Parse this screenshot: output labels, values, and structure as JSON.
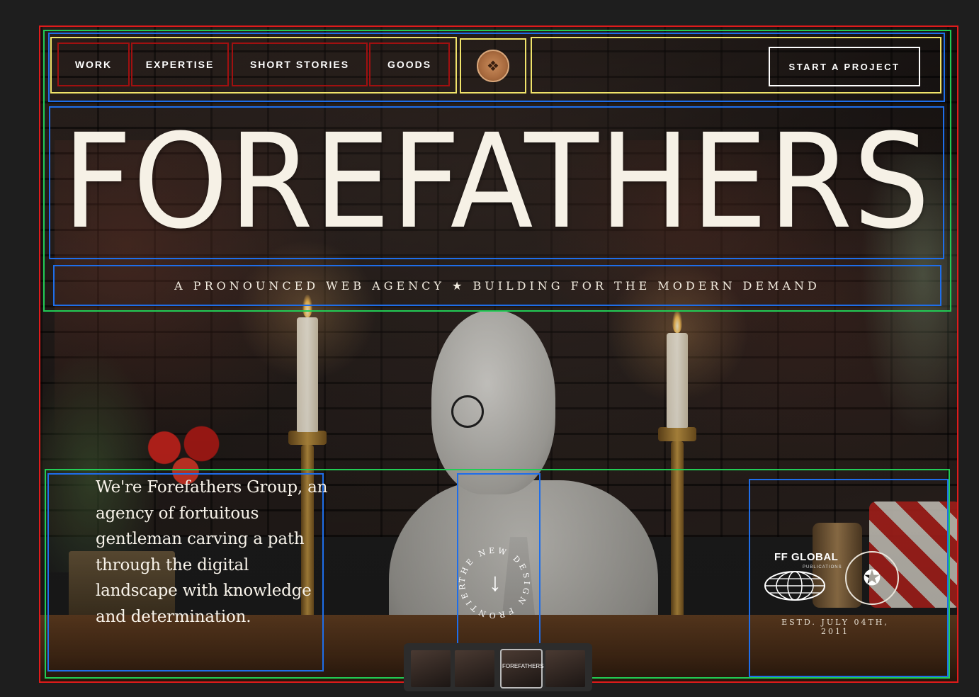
{
  "nav": {
    "items": [
      {
        "label": "WORK"
      },
      {
        "label": "EXPERTISE"
      },
      {
        "label": "SHORT STORIES"
      },
      {
        "label": "GOODS"
      }
    ],
    "cta_label": "START A PROJECT"
  },
  "hero": {
    "title": "FOREFATHERS",
    "tagline": "A PRONOUNCED WEB AGENCY  ★  BUILDING FOR THE MODERN DEMAND"
  },
  "intro": {
    "text": "We're Forefathers Group, an agency of fortuitous gentleman carving a path through the digital landscape with knowledge and determination."
  },
  "scroll_badge": {
    "ring_text": "THE NEW DESIGN FRONTIER",
    "icon": "arrow-down-icon"
  },
  "brands": {
    "fg_logo": "FF GLOBAL",
    "fg_sub": "PUBLICATIONS",
    "established": "ESTD. JULY 04TH, 2011"
  },
  "thumbnails": {
    "active_label": "FOREFATHERS"
  },
  "colors": {
    "outline_red": "#e01b1b",
    "outline_green": "#22cc55",
    "outline_blue": "#1e6eea",
    "outline_yellow": "#f0e36a",
    "outline_darkred": "#a01010",
    "text_cream": "#f6f1e6",
    "seal_copper": "#a86a3e"
  }
}
